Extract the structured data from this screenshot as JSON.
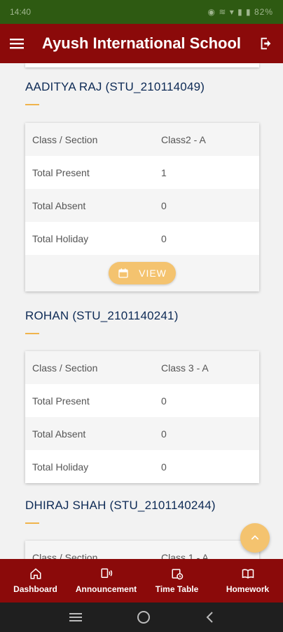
{
  "status_bar": {
    "time": "14:40",
    "battery": "82%"
  },
  "app_bar": {
    "title": "Ayush International School"
  },
  "students": [
    {
      "name": "AADITYA RAJ (STU_210114049)",
      "rows": [
        {
          "label": "Class / Section",
          "value": "Class2 - A"
        },
        {
          "label": "Total Present",
          "value": "1"
        },
        {
          "label": "Total Absent",
          "value": "0"
        },
        {
          "label": "Total Holiday",
          "value": "0"
        }
      ],
      "view_label": "VIEW"
    },
    {
      "name": "ROHAN (STU_2101140241)",
      "rows": [
        {
          "label": "Class / Section",
          "value": "Class 3 - A"
        },
        {
          "label": "Total Present",
          "value": "0"
        },
        {
          "label": "Total Absent",
          "value": "0"
        },
        {
          "label": "Total Holiday",
          "value": "0"
        }
      ]
    },
    {
      "name": "DHIRAJ SHAH (STU_2101140244)",
      "rows": [
        {
          "label": "Class / Section",
          "value": "Class 1 - A"
        }
      ]
    }
  ],
  "bottom_nav": [
    {
      "label": "Dashboard",
      "icon": "home-icon"
    },
    {
      "label": "Announcement",
      "icon": "announcement-icon"
    },
    {
      "label": "Time Table",
      "icon": "timetable-icon"
    },
    {
      "label": "Homework",
      "icon": "homework-icon"
    }
  ],
  "colors": {
    "primary": "#8b0a0a",
    "accent": "#f4c36f",
    "status_bar": "#2e5a12",
    "name_text": "#0d2a55"
  }
}
